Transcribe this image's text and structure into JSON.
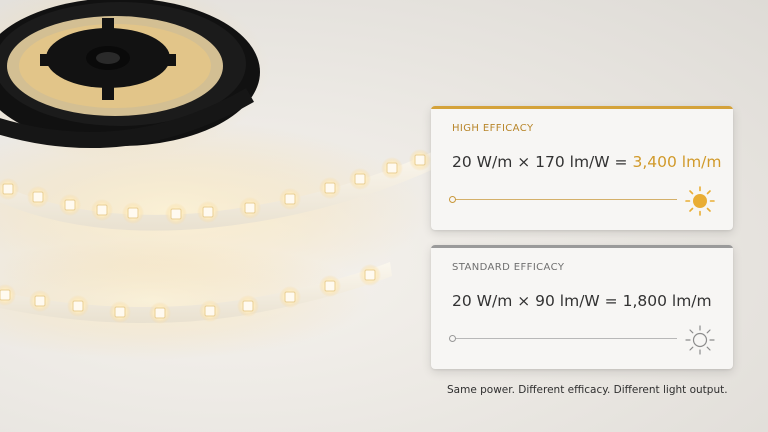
{
  "cards": {
    "high": {
      "label": "HIGH EFFICACY",
      "formula": "20 W/m × 170 lm/W =",
      "result": "3,400 lm/m",
      "icon": "sun-filled-icon",
      "accent": "#d4a23a"
    },
    "standard": {
      "label": "STANDARD EFFICACY",
      "formula": "20 W/m × 90 lm/W = 1,800 lm/m",
      "icon": "sun-outline-icon",
      "accent": "#9a9a9a"
    }
  },
  "tagline": "Same power. Different efficacy. Different light output."
}
